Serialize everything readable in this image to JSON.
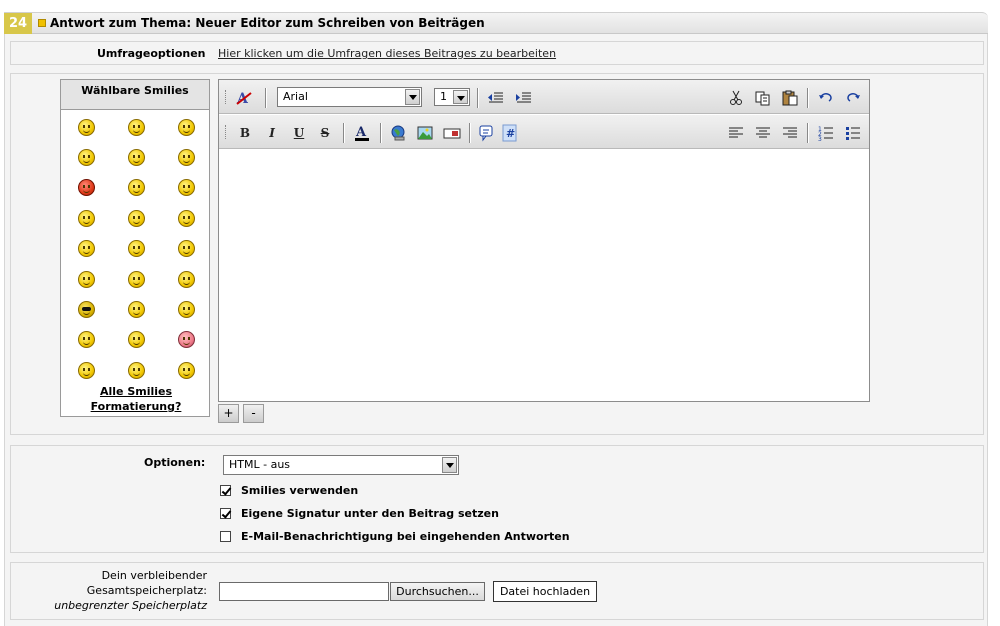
{
  "header": {
    "number_badge": "24",
    "title": "Antwort zum Thema: Neuer Editor zum Schreiben von Beiträgen"
  },
  "poll": {
    "label": "Umfrageoptionen",
    "link": "Hier klicken um die Umfragen dieses Beitrages zu bearbeiten"
  },
  "smilies": {
    "title": "Wählbare Smilies",
    "all_link": "Alle Smilies",
    "format_link": "Formatierung?",
    "items": [
      "smiley-1",
      "smiley-2",
      "smiley-3",
      "smiley-4",
      "smiley-5",
      "smiley-6",
      "smiley-7",
      "smiley-8",
      "smiley-9",
      "smiley-10",
      "smiley-11",
      "smiley-12",
      "smiley-13",
      "smiley-14",
      "smiley-15",
      "smiley-16",
      "smiley-17",
      "smiley-18",
      "smiley-19",
      "smiley-20",
      "smiley-21",
      "smiley-22",
      "smiley-23",
      "smiley-24",
      "smiley-25",
      "smiley-26",
      "smiley-27"
    ]
  },
  "editor": {
    "font": "Arial",
    "size": "1",
    "toolbar": {
      "bold": "B",
      "italic": "I",
      "underline": "U",
      "strike": "S"
    },
    "expand_plus": "+",
    "expand_minus": "-"
  },
  "options": {
    "label": "Optionen:",
    "html_value": "HTML - aus",
    "checkboxes": [
      {
        "label": "Smilies verwenden",
        "checked": true
      },
      {
        "label": "Eigene Signatur unter den Beitrag setzen",
        "checked": true
      },
      {
        "label": "E-Mail-Benachrichtigung bei eingehenden Antworten",
        "checked": false
      }
    ]
  },
  "upload": {
    "label_line1": "Dein verbleibender",
    "label_line2": "Gesamtspeicherplatz:",
    "label_line3": "unbegrenzter Speicherplatz",
    "browse": "Durchsuchen...",
    "upload_button": "Datei hochladen"
  },
  "colors": {
    "badge": "#d8c74a",
    "panel_bg": "#f4f4f4",
    "border": "#d6d6d6"
  }
}
